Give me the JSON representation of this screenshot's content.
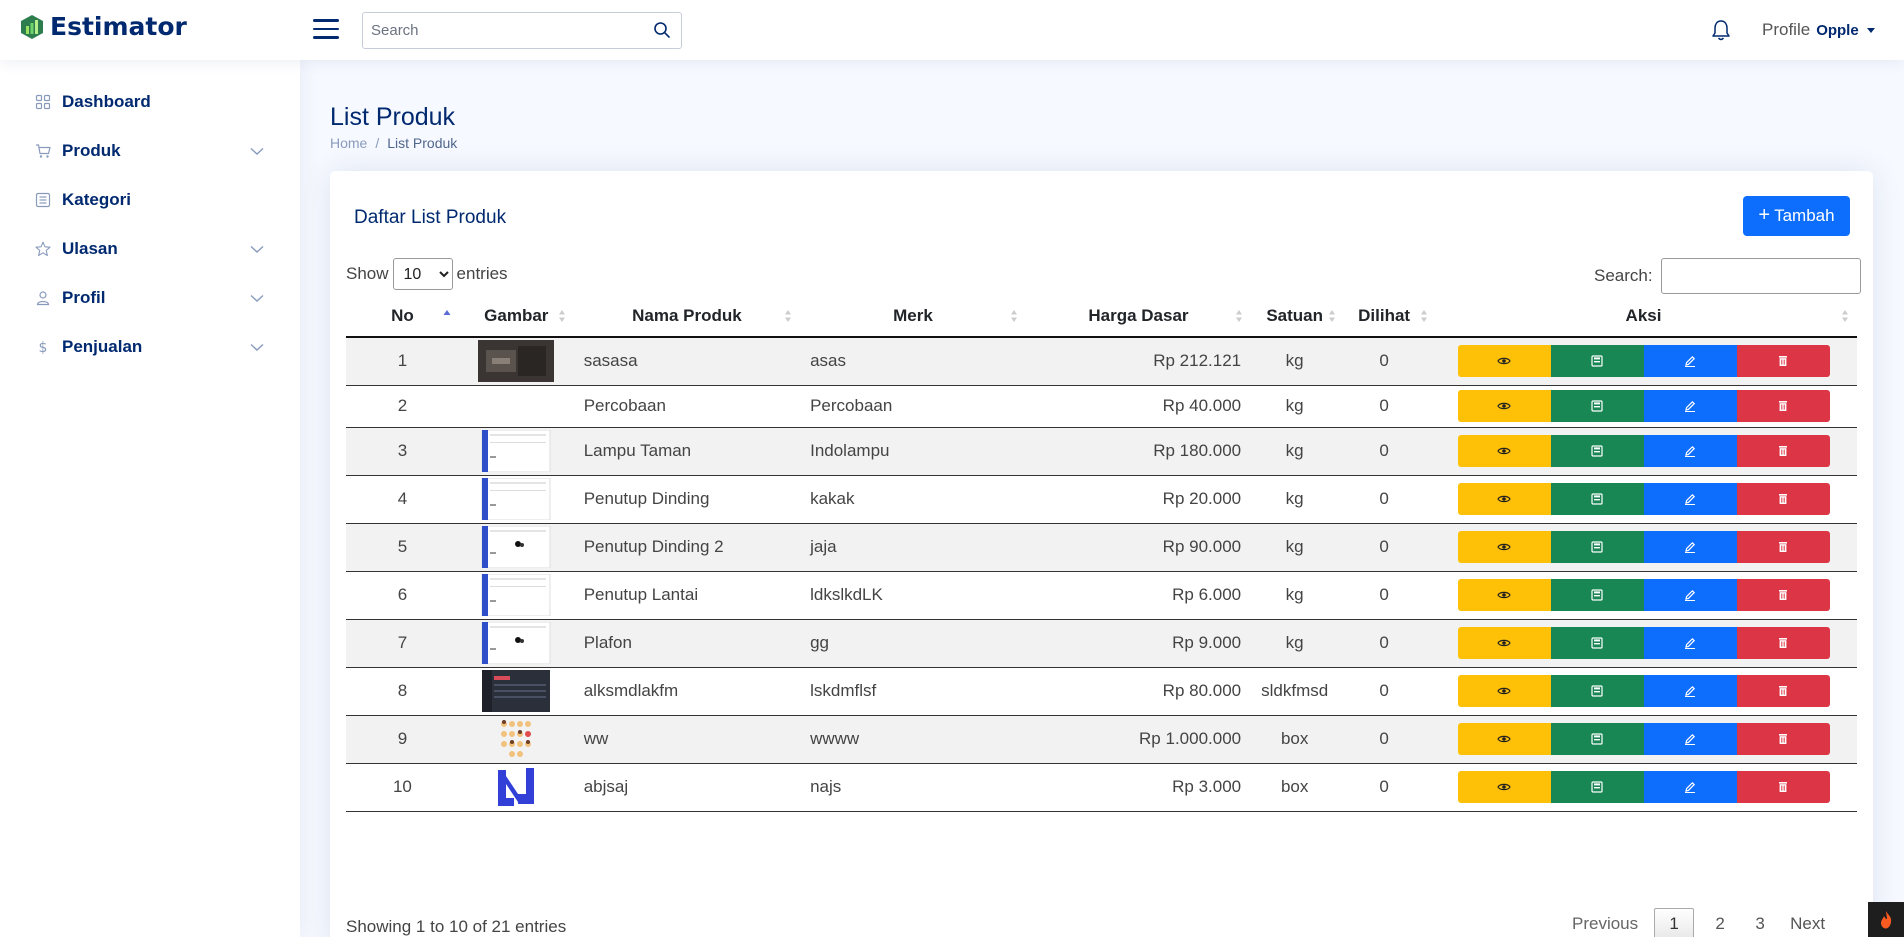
{
  "app": {
    "name": "Estimator"
  },
  "header": {
    "search_placeholder": "Search",
    "profile_alt": "Profile",
    "user_name": "Opple"
  },
  "sidebar": {
    "items": [
      {
        "label": "Dashboard",
        "icon": "grid-icon",
        "expandable": false
      },
      {
        "label": "Produk",
        "icon": "cart-icon",
        "expandable": true
      },
      {
        "label": "Kategori",
        "icon": "list-icon",
        "expandable": false
      },
      {
        "label": "Ulasan",
        "icon": "star-icon",
        "expandable": true
      },
      {
        "label": "Profil",
        "icon": "person-icon",
        "expandable": true
      },
      {
        "label": "Penjualan",
        "icon": "dollar-icon",
        "expandable": true
      }
    ]
  },
  "page": {
    "title": "List Produk",
    "breadcrumb": [
      "Home",
      "/",
      "List Produk"
    ]
  },
  "card": {
    "title": "Daftar List Produk",
    "add_button": "Tambah"
  },
  "table_controls": {
    "show_label": "Show",
    "entries_value": "10",
    "entries_label": "entries",
    "search_label": "Search:"
  },
  "table": {
    "columns": [
      "No",
      "Gambar",
      "Nama Produk",
      "Merk",
      "Harga Dasar",
      "Satuan",
      "Dilihat",
      "Aksi"
    ],
    "rows": [
      {
        "no": "1",
        "image": "dark-photo",
        "nama": "sasasa",
        "merk": "asas",
        "harga": "Rp 212.121",
        "satuan": "kg",
        "dilihat": "0"
      },
      {
        "no": "2",
        "image": "none",
        "nama": "Percobaan",
        "merk": "Percobaan",
        "harga": "Rp 40.000",
        "satuan": "kg",
        "dilihat": "0"
      },
      {
        "no": "3",
        "image": "screenshot-light",
        "nama": "Lampu Taman",
        "merk": "Indolampu",
        "harga": "Rp 180.000",
        "satuan": "kg",
        "dilihat": "0"
      },
      {
        "no": "4",
        "image": "screenshot-light",
        "nama": "Penutup Dinding",
        "merk": "kakak",
        "harga": "Rp 20.000",
        "satuan": "kg",
        "dilihat": "0"
      },
      {
        "no": "5",
        "image": "screenshot-dot",
        "nama": "Penutup Dinding 2",
        "merk": "jaja",
        "harga": "Rp 90.000",
        "satuan": "kg",
        "dilihat": "0"
      },
      {
        "no": "6",
        "image": "screenshot-light",
        "nama": "Penutup Lantai",
        "merk": "ldkslkdLK",
        "harga": "Rp 6.000",
        "satuan": "kg",
        "dilihat": "0"
      },
      {
        "no": "7",
        "image": "screenshot-dot",
        "nama": "Plafon",
        "merk": "gg",
        "harga": "Rp 9.000",
        "satuan": "kg",
        "dilihat": "0"
      },
      {
        "no": "8",
        "image": "screenshot-dark",
        "nama": "alksmdlakfm",
        "merk": "lskdmflsf",
        "harga": "Rp 80.000",
        "satuan": "sldkfmsd",
        "dilihat": "0"
      },
      {
        "no": "9",
        "image": "emoji-grid",
        "nama": "ww",
        "merk": "wwww",
        "harga": "Rp 1.000.000",
        "satuan": "box",
        "dilihat": "0"
      },
      {
        "no": "10",
        "image": "blue-logo",
        "nama": "abjsaj",
        "merk": "najs",
        "harga": "Rp 3.000",
        "satuan": "box",
        "dilihat": "0"
      }
    ]
  },
  "footer": {
    "info": "Showing 1 to 10 of 21 entries",
    "previous": "Previous",
    "pages": [
      "1",
      "2",
      "3"
    ],
    "next": "Next"
  },
  "colors": {
    "brand": "#012970",
    "view": "#ffc107",
    "save": "#198754",
    "edit": "#0d6efd",
    "delete": "#dc3545"
  }
}
